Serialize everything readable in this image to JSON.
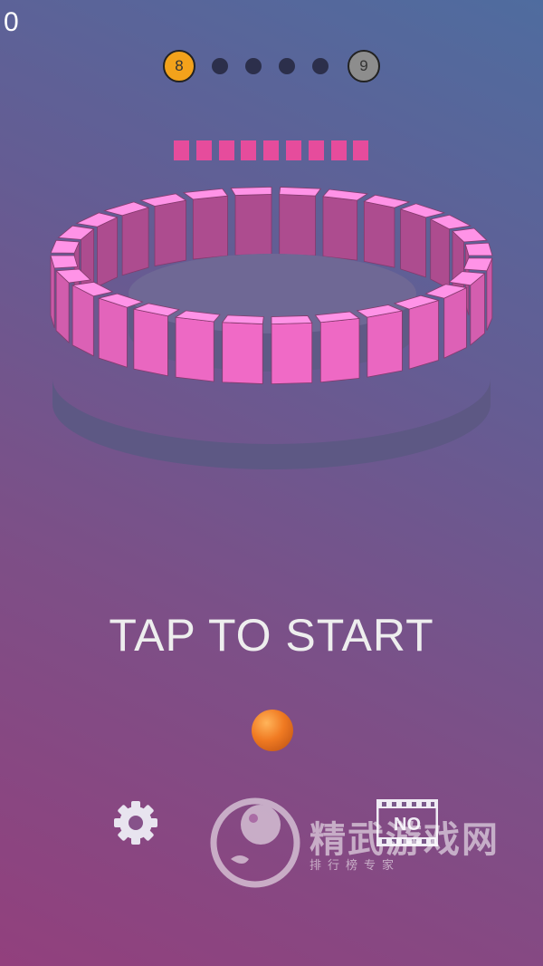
{
  "score": "0",
  "level": {
    "current": "8",
    "next": "9",
    "stage_dots": 4
  },
  "segments_remaining": 9,
  "prompt": "TAP TO START",
  "icons": {
    "settings": "gear-icon",
    "no_ads": "no-ads-film-icon",
    "watermark_logo": "watermark-logo-icon"
  },
  "no_ads_text": "NO",
  "watermark": {
    "title": "精武游戏网",
    "subtitle": "排行榜专家"
  },
  "colors": {
    "current_level": "#f3a21b",
    "next_level": "#8d8d8d",
    "segment": "#e64c9c",
    "block_front": "#f06ac6",
    "block_top": "#ff93e7",
    "ball": "#f07a22",
    "platform": "#6c6690"
  }
}
